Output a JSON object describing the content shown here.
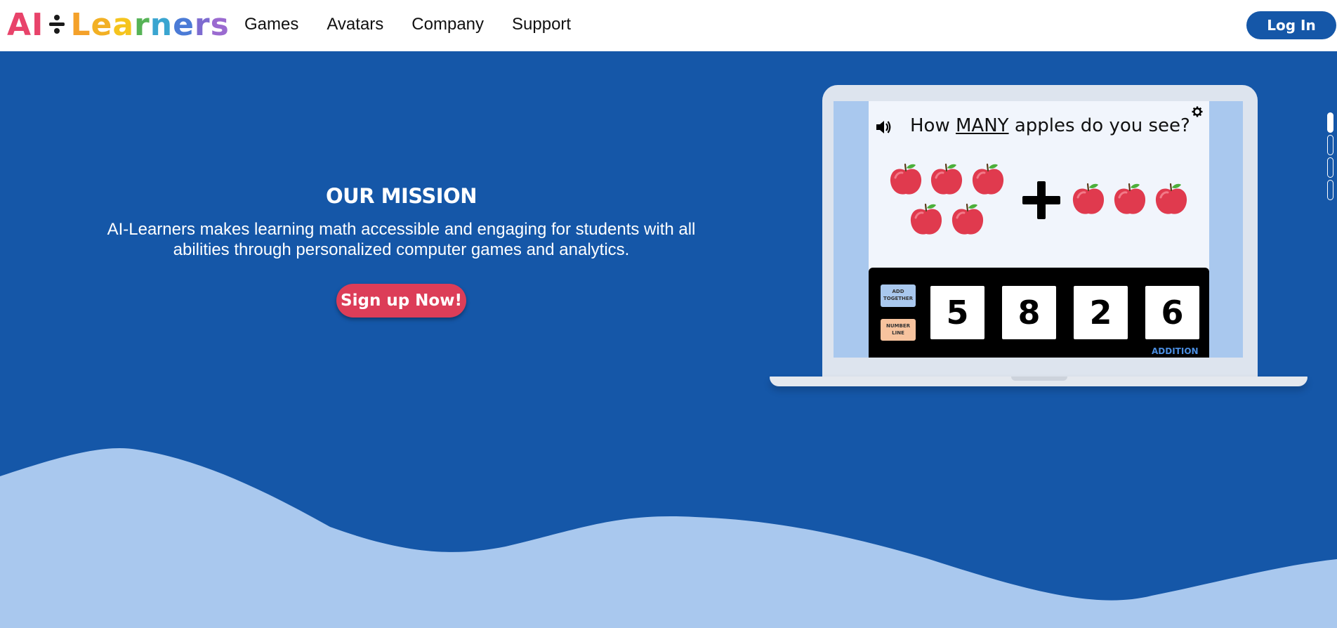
{
  "brand": {
    "ai": "AI",
    "learners": [
      "L",
      "e",
      "a",
      "r",
      "n",
      "e",
      "r",
      "s"
    ],
    "learner_colors": [
      "#f4a12a",
      "#f2b024",
      "#f5c41e",
      "#56b356",
      "#3aa5d0",
      "#4b7bd6",
      "#7d6bd0",
      "#9a6ad0"
    ],
    "ai_color": "#e8436a"
  },
  "nav": {
    "items": [
      "Games",
      "Avatars",
      "Company",
      "Support"
    ],
    "login": "Log In"
  },
  "hero": {
    "title": "OUR MISSION",
    "description": "AI-Learners makes learning math accessible and engaging for students with all abilities through personalized computer games and analytics.",
    "cta": "Sign up Now!"
  },
  "game": {
    "question_pre": "How ",
    "question_emph": "MANY",
    "question_post": " apples do you see?",
    "answers": [
      "5",
      "8",
      "2",
      "6"
    ],
    "tag_add": "ADD TOGETHER",
    "tag_line": "NUMBER LINE",
    "mode": "ADDITION",
    "left_apples": 5,
    "right_apples": 3
  },
  "colors": {
    "primary": "#1557a8",
    "wave": "#a9c8ee",
    "cta": "#dc3d58",
    "apple": "#e03a4e"
  },
  "scroll_indicator": {
    "count": 4,
    "active_index": 0
  }
}
